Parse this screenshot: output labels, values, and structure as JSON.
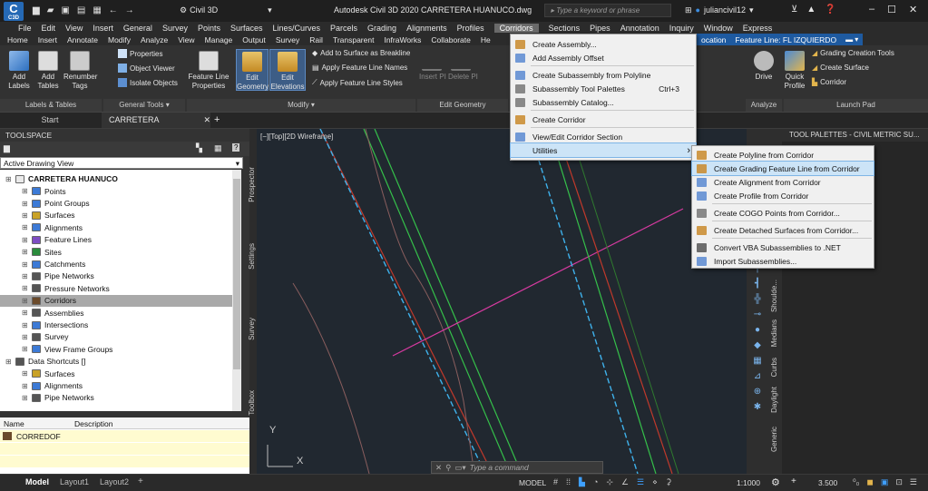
{
  "titlebar": {
    "workspace": "Civil 3D",
    "title": "Autodesk Civil 3D 2020   CARRETERA HUANUCO.dwg",
    "search_placeholder": "Type a keyword or phrase",
    "user": "juliancivil12",
    "app_badge": "C3D"
  },
  "menubar": {
    "items": [
      "File",
      "Edit",
      "View",
      "Insert",
      "General",
      "Survey",
      "Points",
      "Surfaces",
      "Lines/Curves",
      "Parcels",
      "Grading",
      "Alignments",
      "Profiles",
      "Corridors",
      "Sections",
      "Pipes",
      "Annotation",
      "Inquiry",
      "Window",
      "Express"
    ]
  },
  "ribbon": {
    "tabs": [
      "Home",
      "Insert",
      "Annotate",
      "Modify",
      "Analyze",
      "View",
      "Manage",
      "Output",
      "Survey",
      "Rail",
      "Transparent",
      "InfraWorks",
      "Collaborate",
      "He"
    ],
    "context_tabs": [
      "ocation",
      "Feature Line: FL IZQUIERDO"
    ],
    "buttons": {
      "add_labels": "Add\nLabels",
      "add_tables": "Add\nTables",
      "renumber_tags": "Renumber\nTags",
      "properties": "Properties",
      "object_viewer": "Object Viewer",
      "isolate_objects": "Isolate Objects",
      "feature_line_properties": "Feature Line\nProperties",
      "edit_geometry": "Edit\nGeometry",
      "edit_elevations": "Edit\nElevations",
      "add_surface_breakline": "Add to Surface as Breakline",
      "apply_fl_names": "Apply Feature Line Names",
      "apply_fl_styles": "Apply Feature Line Styles",
      "insert_pi": "Insert PI",
      "delete_pi": "Delete PI",
      "drive": "Drive",
      "quick_profile": "Quick\nProfile",
      "grading_creation_tools": "Grading Creation Tools",
      "create_surface": "Create Surface",
      "corridor": "Corridor"
    },
    "groups": {
      "labels_tables": "Labels & Tables",
      "general_tools": "General Tools ▾",
      "modify": "Modify ▾",
      "edit_geometry": "Edit Geometry",
      "analyze": "Analyze",
      "launch_pad": "Launch Pad"
    }
  },
  "doctabs": {
    "start": "Start",
    "active": "CARRETERA HUANUCO*",
    "close": "✕",
    "plus": "+"
  },
  "toolspace": {
    "title": "TOOLSPACE",
    "view_dropdown": "Active Drawing View",
    "tree": [
      {
        "label": "CARRETERA HUANUCO",
        "indent": 0,
        "bold": true,
        "color": "#eaeaea"
      },
      {
        "label": "Points",
        "indent": 1,
        "color": "#3c7ad6"
      },
      {
        "label": "Point Groups",
        "indent": 1,
        "color": "#3c7ad6"
      },
      {
        "label": "Surfaces",
        "indent": 1,
        "color": "#c9a227"
      },
      {
        "label": "Alignments",
        "indent": 1,
        "color": "#3c7ad6"
      },
      {
        "label": "Feature Lines",
        "indent": 1,
        "color": "#7d4cc2"
      },
      {
        "label": "Sites",
        "indent": 1,
        "color": "#2a8c3c"
      },
      {
        "label": "Catchments",
        "indent": 1,
        "color": "#3c7ad6"
      },
      {
        "label": "Pipe Networks",
        "indent": 1,
        "color": "#555"
      },
      {
        "label": "Pressure Networks",
        "indent": 1,
        "color": "#555"
      },
      {
        "label": "Corridors",
        "indent": 1,
        "color": "#6b4a2a",
        "selected": true
      },
      {
        "label": "Assemblies",
        "indent": 1,
        "color": "#555"
      },
      {
        "label": "Intersections",
        "indent": 1,
        "color": "#3c7ad6"
      },
      {
        "label": "Survey",
        "indent": 1,
        "color": "#555"
      },
      {
        "label": "View Frame Groups",
        "indent": 1,
        "color": "#3c7ad6"
      },
      {
        "label": "Data Shortcuts []",
        "indent": 0,
        "color": "#555"
      },
      {
        "label": "Surfaces",
        "indent": 1,
        "color": "#c9a227"
      },
      {
        "label": "Alignments",
        "indent": 1,
        "color": "#3c7ad6"
      },
      {
        "label": "Pipe Networks",
        "indent": 1,
        "color": "#555"
      }
    ],
    "list_headers": [
      "Name",
      "Description"
    ],
    "list_rows": [
      {
        "name": "CORREDOF",
        "description": ""
      }
    ],
    "side_tabs": [
      "Prospector",
      "Settings",
      "Survey",
      "Toolbox"
    ]
  },
  "viewport": {
    "label": "[−][Top][2D Wireframe]",
    "axis_y": "Y",
    "axis_x": "X",
    "command_placeholder": "Type a command"
  },
  "corridors_menu": {
    "items": [
      {
        "label": "Create Assembly...",
        "icon_color": "#c98a2c"
      },
      {
        "label": "Add Assembly Offset",
        "icon_color": "#5a8ad1"
      },
      {
        "label": "Create Subassembly from Polyline",
        "icon_color": "#5a8ad1",
        "sep_before": true
      },
      {
        "label": "Subassembly Tool Palettes",
        "icon_color": "#777",
        "shortcut": "Ctrl+3"
      },
      {
        "label": "Subassembly Catalog...",
        "icon_color": "#777"
      },
      {
        "label": "Create Corridor",
        "icon_color": "#c98a2c",
        "sep_before": true
      },
      {
        "label": "View/Edit Corridor Section",
        "icon_color": "#5a8ad1",
        "sep_before": true
      },
      {
        "label": "Utilities",
        "icon_color": "",
        "highlighted": true,
        "submenu": true
      }
    ]
  },
  "utilities_menu": {
    "items": [
      {
        "label": "Create Polyline from Corridor",
        "icon_color": "#c98a2c"
      },
      {
        "label": "Create Grading Feature Line from Corridor",
        "icon_color": "#c98a2c",
        "highlighted": true
      },
      {
        "label": "Create Alignment from Corridor",
        "icon_color": "#5a8ad1"
      },
      {
        "label": "Create Profile from Corridor",
        "icon_color": "#5a8ad1"
      },
      {
        "label": "Create COGO Points from Corridor...",
        "icon_color": "#777",
        "sep_before": true
      },
      {
        "label": "Create Detached Surfaces from Corridor...",
        "icon_color": "#c98a2c",
        "sep_before": true
      },
      {
        "label": "Convert VBA Subassemblies to .NET",
        "icon_color": "#555",
        "sep_before": true
      },
      {
        "label": "Import Subassemblies...",
        "icon_color": "#5a8ad1"
      }
    ]
  },
  "tool_palette": {
    "title": "TOOL PALETTES - CIVIL METRIC SU...",
    "tabs": [
      "Generic",
      "Daylight",
      "Curbs",
      "Medians",
      "Shoulde..."
    ]
  },
  "statusbar": {
    "tabs": [
      "Model",
      "Layout1",
      "Layout2",
      "+"
    ],
    "model_label": "MODEL",
    "scale": "1:1000",
    "value": "3.500"
  },
  "colors": {
    "accent": "#0078d7",
    "menu_highlight": "#cce4f7",
    "tree_selected": "#a9a9a9"
  }
}
